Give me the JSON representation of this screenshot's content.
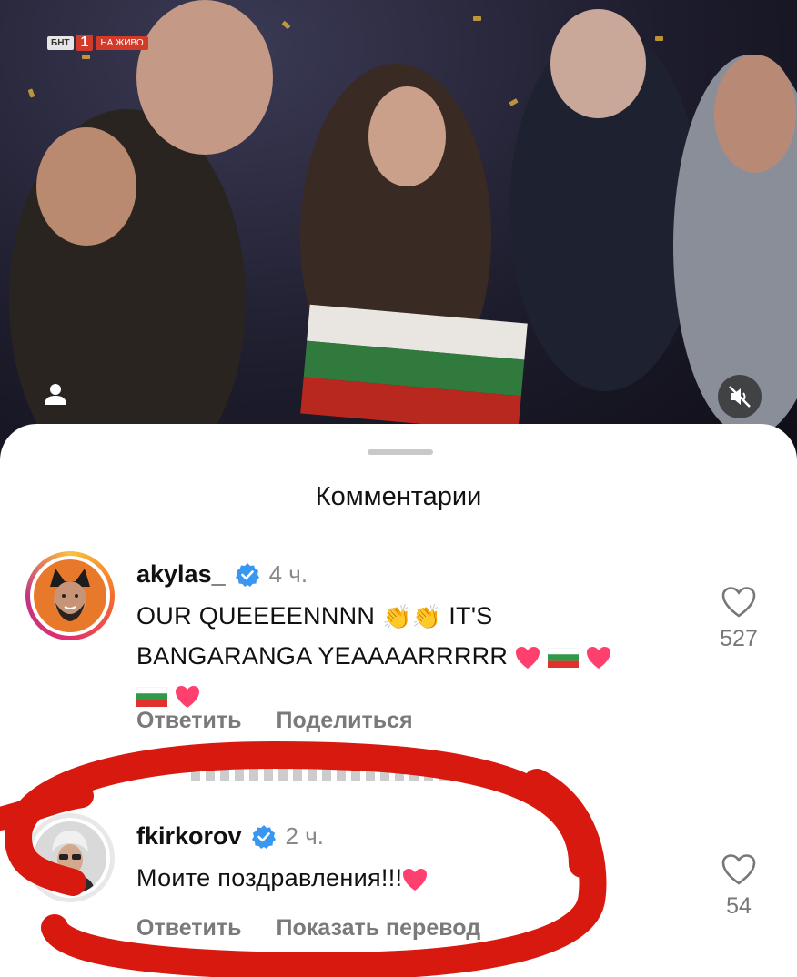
{
  "video": {
    "channel": {
      "logo_text": "БНТ",
      "number": "1",
      "live_label": "НА ЖИВО"
    },
    "icons": {
      "profile": "person-icon",
      "sound": "speaker-muted-icon"
    }
  },
  "sheet": {
    "title": "Комментарии"
  },
  "comments": [
    {
      "username": "akylas_",
      "verified": true,
      "time": "4 ч.",
      "text_line1": "OUR QUEEEENNNN",
      "text_line1_after": "IT'S",
      "text_line2": "BANGARANGA YEAAAARRRRR",
      "emojis": [
        "clapping-hands",
        "clapping-hands",
        "heart",
        "bulgarian-flag",
        "heart",
        "bulgarian-flag",
        "heart"
      ],
      "actions": [
        "Ответить",
        "Поделиться"
      ],
      "likes": "527",
      "colors": {
        "avatar_bg": "#e8792b"
      }
    },
    {
      "username": "fkirkorov",
      "verified": true,
      "time": "2 ч.",
      "text": "Моите поздравления!!!",
      "emojis": [
        "heart"
      ],
      "actions": [
        "Ответить",
        "Показать перевод"
      ],
      "likes": "54"
    }
  ],
  "colors": {
    "verified_blue": "#3897f0",
    "heart_pink": "#ff3f6e",
    "highlight_red": "#d8190f",
    "secondary_text": "#7a7a7a"
  }
}
